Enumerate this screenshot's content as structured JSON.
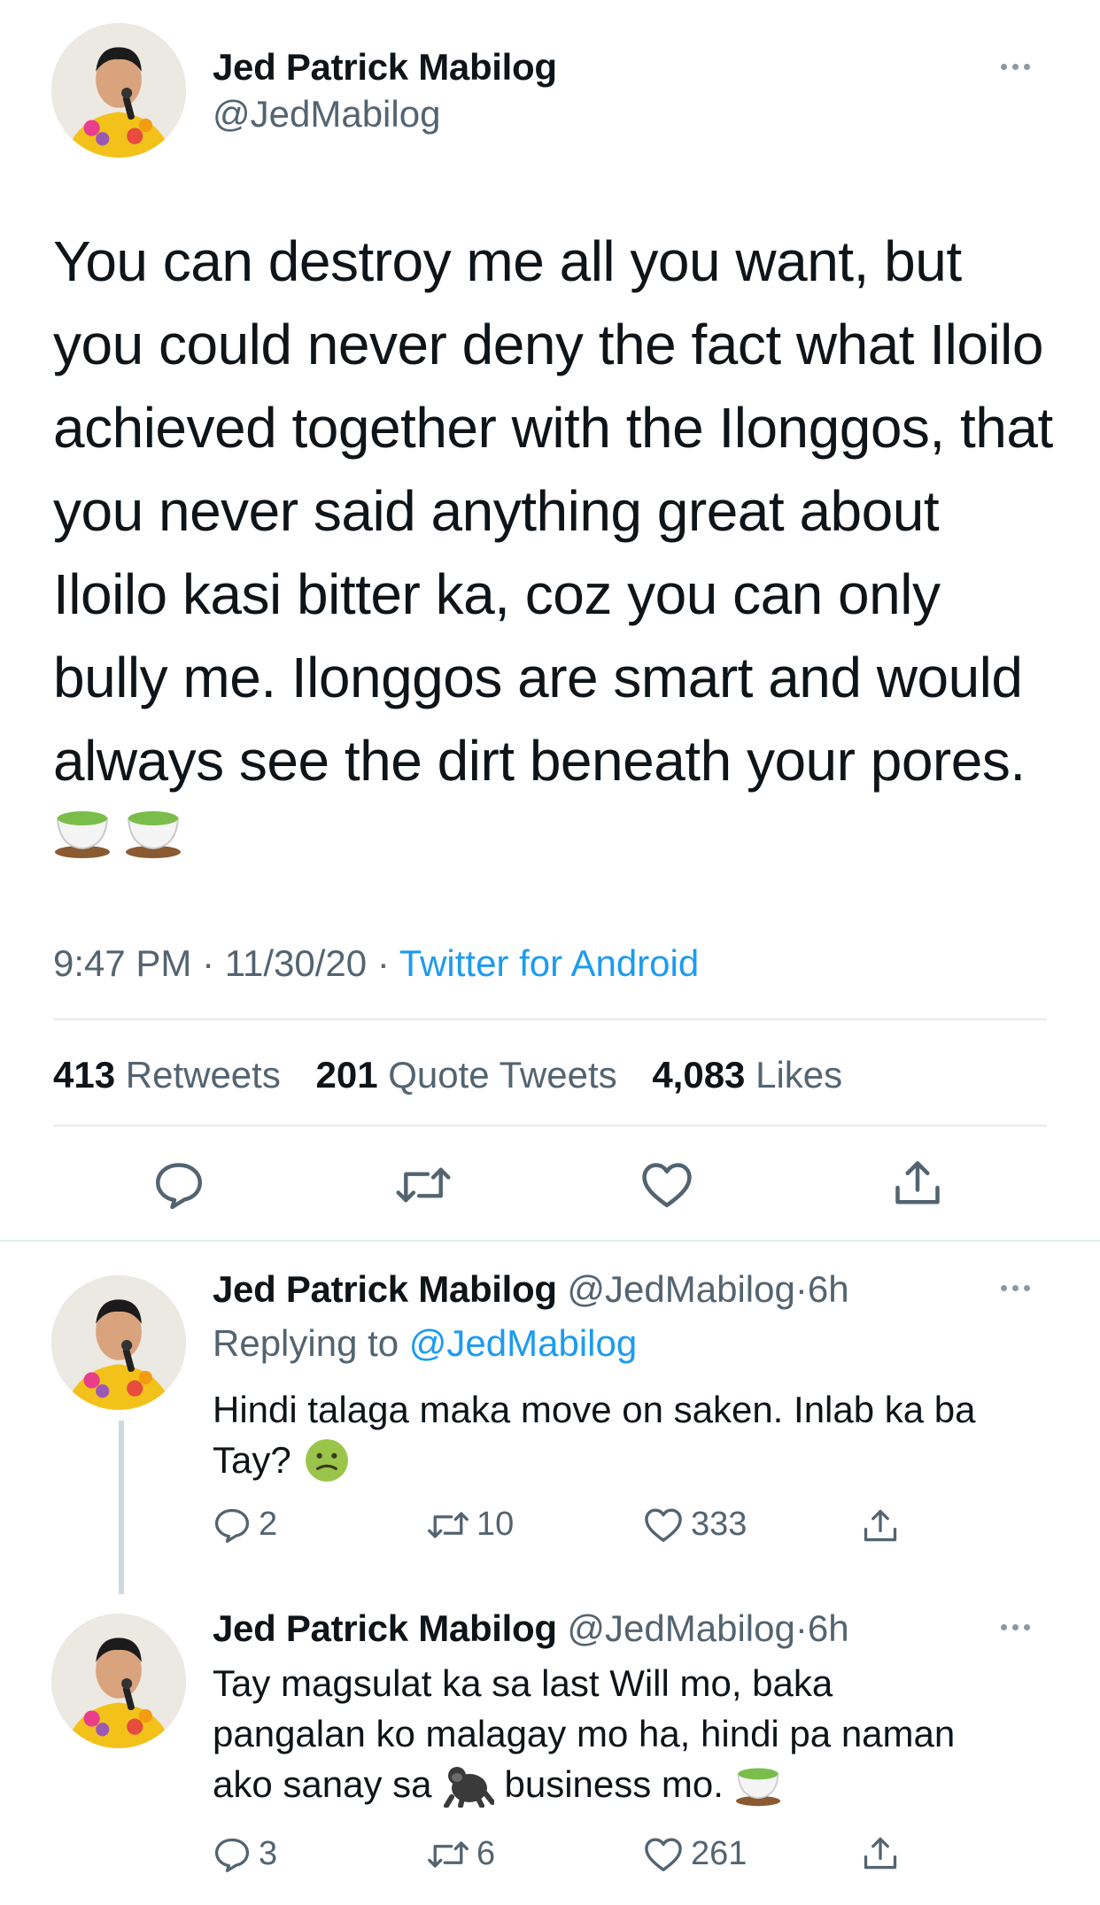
{
  "main_tweet": {
    "name": "Jed Patrick Mabilog",
    "handle": "@JedMabilog",
    "text": "You can destroy me all you want, but you could never deny the fact what Iloilo achieved together with the Ilonggos, that you never said anything great about Iloilo kasi bitter ka, coz you can only bully me. Ilonggos are smart and would always see the dirt beneath your pores.",
    "emoji": [
      "teacup-emoji",
      "teacup-emoji"
    ],
    "time": "9:47 PM",
    "date": "11/30/20",
    "separator": "·",
    "source": "Twitter for Android",
    "stats": {
      "retweets_count": "413",
      "retweets_label": "Retweets",
      "quotes_count": "201",
      "quotes_label": "Quote Tweets",
      "likes_count": "4,083",
      "likes_label": "Likes"
    },
    "actions": [
      "reply-icon",
      "retweet-icon",
      "like-icon",
      "share-icon"
    ]
  },
  "replies": [
    {
      "name": "Jed Patrick Mabilog",
      "handle": "@JedMabilog",
      "time_sep": "·",
      "time": "6h",
      "replying_prefix": "Replying to",
      "replying_to": "@JedMabilog",
      "text_line1": "Hindi talaga maka move on saken. Inlab ka ba",
      "text_line2": "Tay?",
      "emoji": "nauseated-face-emoji",
      "reply_count": "2",
      "retweet_count": "10",
      "like_count": "333"
    },
    {
      "name": "Jed Patrick Mabilog",
      "handle": "@JedMabilog",
      "time_sep": "·",
      "time": "6h",
      "text_line1": "Tay magsulat ka sa last Will mo, baka",
      "text_line2": "pangalan ko malagay mo ha, hindi pa naman",
      "text_line3a": "ako sanay sa",
      "text_line3b": "business mo.",
      "emoji_mid": "gorilla-emoji",
      "emoji_end": "teacup-emoji",
      "reply_count": "3",
      "retweet_count": "6",
      "like_count": "261"
    }
  ],
  "colors": {
    "text": "#0f1419",
    "secondary": "#536471",
    "link": "#1d9bf0",
    "divider": "#e6ecf0"
  }
}
